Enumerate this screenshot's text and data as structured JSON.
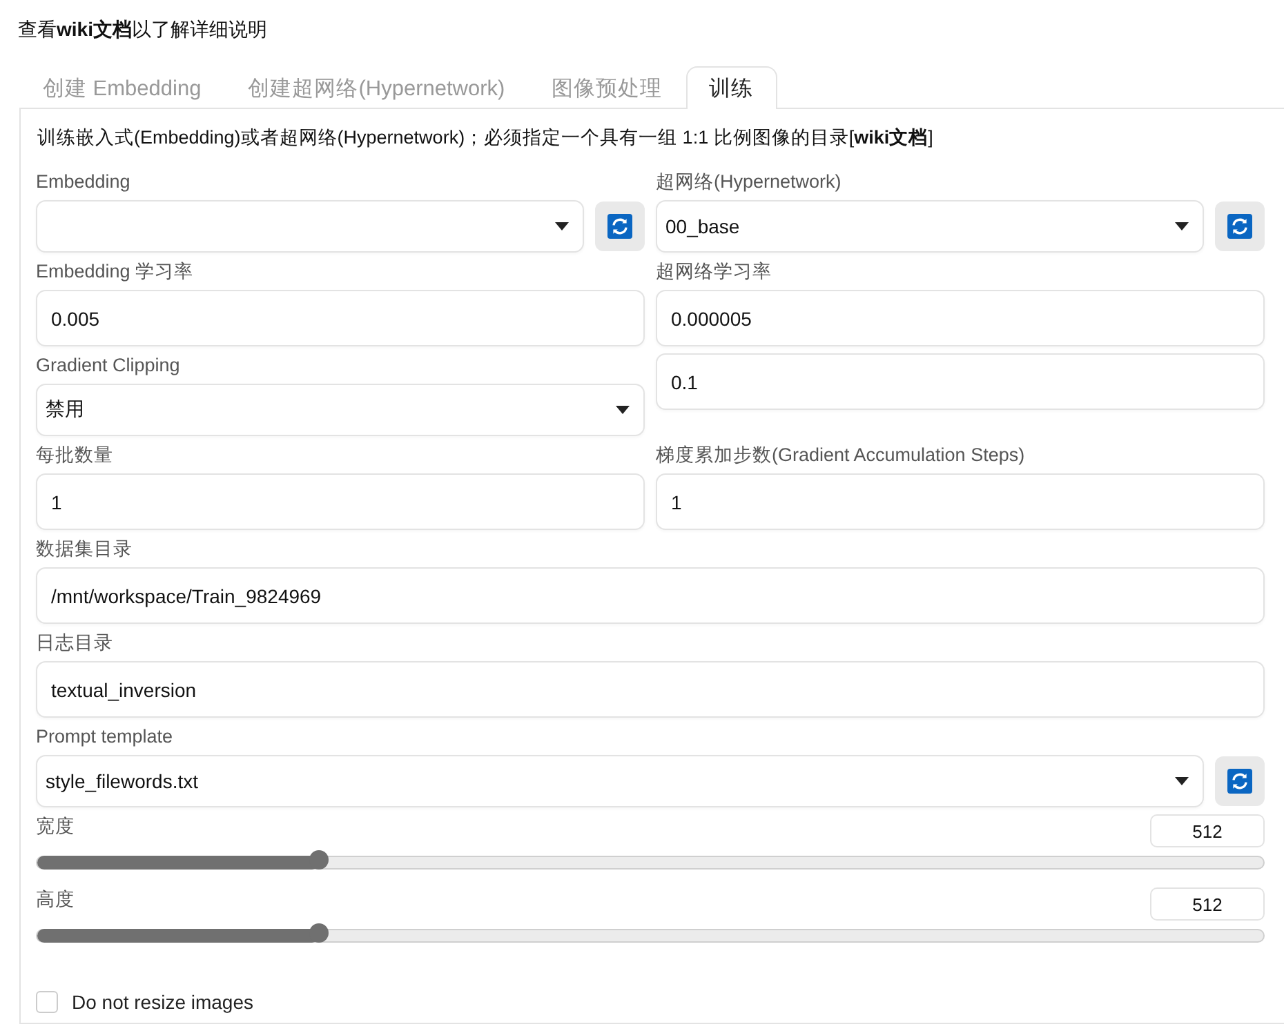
{
  "header": {
    "text": "查看**wiki文档**以了解详细说明"
  },
  "tabs": [
    {
      "label": "创建 Embedding",
      "selected": false
    },
    {
      "label": "创建超网络(Hypernetwork)",
      "selected": false
    },
    {
      "label": "图像预处理",
      "selected": false
    },
    {
      "label": "训练",
      "selected": true
    }
  ],
  "panel": {
    "description": "训练嵌入式(Embedding)或者超网络(Hypernetwork)；必须指定一个具有一组 1:1 比例图像的目录[**wiki文档**]",
    "rows": [
      {
        "fields": [
          {
            "kind": "dropdown",
            "label": "Embedding",
            "refresh": true
          },
          {
            "kind": "dropdown",
            "label": "超网络(Hypernetwork)",
            "value": "00_base",
            "refresh": true
          }
        ]
      },
      {
        "fields": [
          {
            "kind": "input",
            "label": "Embedding 学习率",
            "value": "0.005"
          },
          {
            "kind": "input",
            "label": "超网络学习率",
            "value": "0.000005"
          }
        ]
      },
      {
        "fields": [
          {
            "kind": "dropdown",
            "label": "Gradient Clipping",
            "value": "禁用",
            "refresh": false
          },
          {
            "kind": "input",
            "value": "0.1"
          }
        ]
      },
      {
        "fields": [
          {
            "kind": "input",
            "label": "每批数量",
            "value": "1"
          },
          {
            "kind": "input",
            "label": "梯度累加步数(Gradient Accumulation Steps)",
            "value": "1"
          }
        ]
      },
      {
        "fields": [
          {
            "kind": "input",
            "label": "数据集目录",
            "value": "/mnt/workspace/Train_9824969"
          }
        ]
      },
      {
        "fields": [
          {
            "kind": "input",
            "label": "日志目录",
            "value": "textual_inversion"
          }
        ]
      },
      {
        "fields": [
          {
            "kind": "dropdown",
            "label": "Prompt template",
            "value": "style_filewords.txt",
            "refresh": true
          }
        ]
      },
      {
        "fields": [
          {
            "kind": "slider",
            "label": "宽度",
            "value": "512",
            "level": 0.23
          }
        ]
      },
      {
        "fields": [
          {
            "kind": "slider",
            "label": "高度",
            "value": "512",
            "level": 0.23
          }
        ]
      },
      {
        "fields": [
          {
            "kind": "checkbox",
            "label": "Do not resize images",
            "checked": false
          }
        ]
      }
    ]
  }
}
